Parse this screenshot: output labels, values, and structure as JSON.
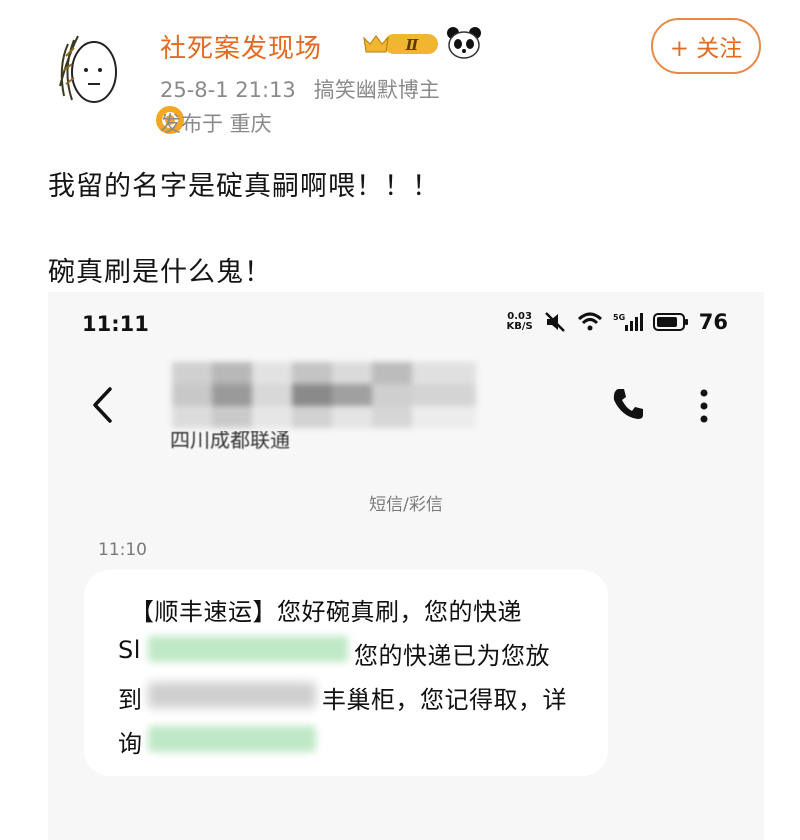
{
  "post": {
    "username": "社死案发现场",
    "vip_label": "Ⅱ",
    "timestamp": "25-8-1 21:13",
    "user_tag": "搞笑幽默博主",
    "location": "发布于 重庆",
    "follow_label": "+ 关注",
    "text_line_1": "我留的名字是碇真嗣啊喂！！！",
    "text_line_2": "碗真刷是什么鬼！"
  },
  "screenshot": {
    "status_time": "11:11",
    "net_speed_value": "0.03",
    "net_speed_unit": "KB/S",
    "battery": "76",
    "sender_location": "四川成都联通",
    "sms_label": "短信/彩信",
    "message_time": "11:10",
    "message_lines": [
      "【顺丰速运】您好碗真刷，您的快递",
      "Sl",
      "您的快递已为您放",
      "到",
      "丰巢柜，您记得取，详",
      "询"
    ]
  },
  "colors": {
    "username": "#e46a21",
    "follow_border": "#e8894a",
    "meta": "#8a8a8a",
    "verified": "#f5a623"
  },
  "icons": [
    "avatar-doodle",
    "verified-icon",
    "vip-badge-icon",
    "panda-icon",
    "back-icon",
    "phone-icon",
    "more-icon",
    "wifi-icon",
    "signal-icon",
    "battery-icon",
    "mute-icon"
  ]
}
